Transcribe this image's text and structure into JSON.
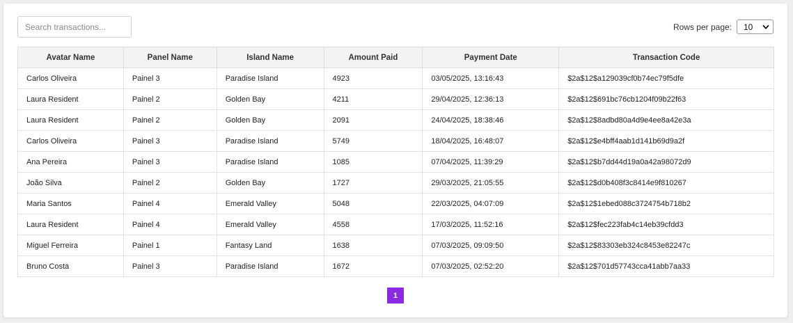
{
  "search": {
    "placeholder": "Search transactions...",
    "value": ""
  },
  "rows_per_page": {
    "label": "Rows per page:",
    "selected": "10"
  },
  "table": {
    "columns": [
      "Avatar Name",
      "Panel Name",
      "Island Name",
      "Amount Paid",
      "Payment Date",
      "Transaction Code"
    ],
    "rows": [
      [
        "Carlos Oliveira",
        "Painel 3",
        "Paradise Island",
        "4923",
        "03/05/2025, 13:16:43",
        "$2a$12$a129039cf0b74ec79f5dfe"
      ],
      [
        "Laura Resident",
        "Painel 2",
        "Golden Bay",
        "4211",
        "29/04/2025, 12:36:13",
        "$2a$12$691bc76cb1204f09b22f63"
      ],
      [
        "Laura Resident",
        "Painel 2",
        "Golden Bay",
        "2091",
        "24/04/2025, 18:38:46",
        "$2a$12$8adbd80a4d9e4ee8a42e3a"
      ],
      [
        "Carlos Oliveira",
        "Painel 3",
        "Paradise Island",
        "5749",
        "18/04/2025, 16:48:07",
        "$2a$12$e4bff4aab1d141b69d9a2f"
      ],
      [
        "Ana Pereira",
        "Painel 3",
        "Paradise Island",
        "1085",
        "07/04/2025, 11:39:29",
        "$2a$12$b7dd44d19a0a42a98072d9"
      ],
      [
        "João Silva",
        "Painel 2",
        "Golden Bay",
        "1727",
        "29/03/2025, 21:05:55",
        "$2a$12$d0b408f3c8414e9f810267"
      ],
      [
        "Maria Santos",
        "Painel 4",
        "Emerald Valley",
        "5048",
        "22/03/2025, 04:07:09",
        "$2a$12$1ebed088c3724754b718b2"
      ],
      [
        "Laura Resident",
        "Painel 4",
        "Emerald Valley",
        "4558",
        "17/03/2025, 11:52:16",
        "$2a$12$fec223fab4c14eb39cfdd3"
      ],
      [
        "Miguel Ferreira",
        "Painel 1",
        "Fantasy Land",
        "1638",
        "07/03/2025, 09:09:50",
        "$2a$12$83303eb324c8453e82247c"
      ],
      [
        "Bruno Costa",
        "Painel 3",
        "Paradise Island",
        "1672",
        "07/03/2025, 02:52:20",
        "$2a$12$701d57743cca41abb7aa33"
      ]
    ]
  },
  "pagination": {
    "current_page": "1",
    "active_color": "#8a2be2"
  },
  "icons": {
    "select_arrow": "chevron-down-icon"
  }
}
